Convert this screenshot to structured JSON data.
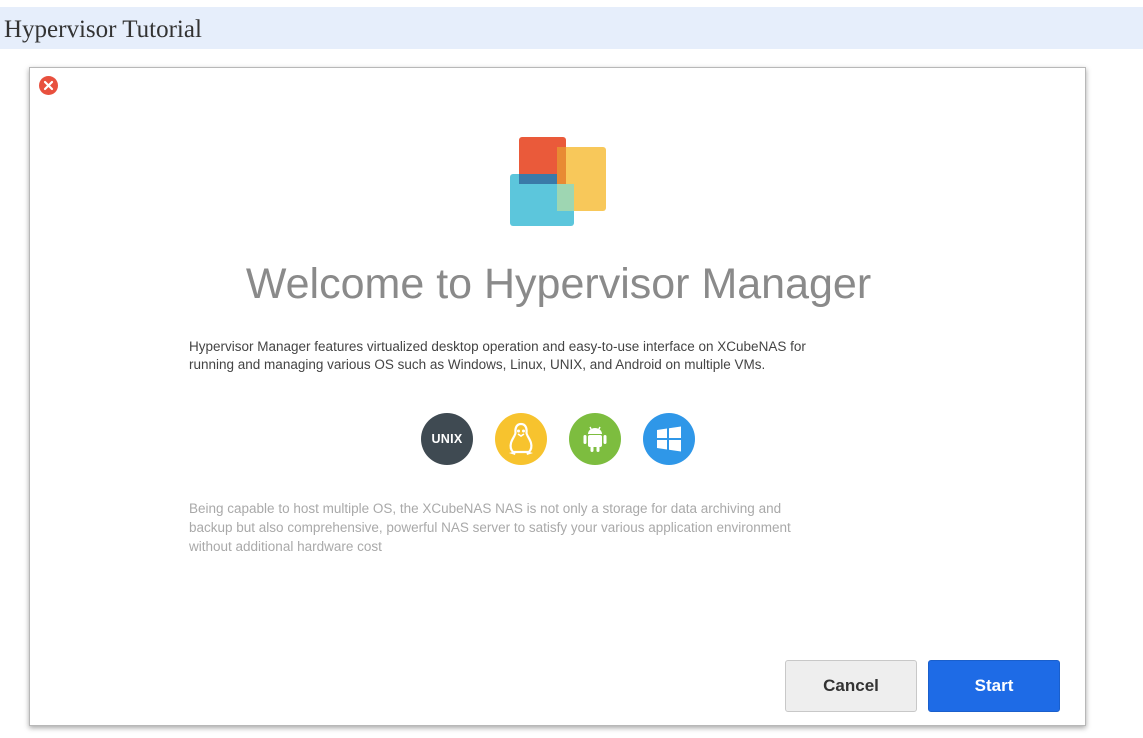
{
  "window": {
    "title": "Hypervisor Tutorial"
  },
  "dialog": {
    "heading": "Welcome to Hypervisor Manager",
    "description_line1": "Hypervisor Manager features virtualized desktop operation and easy-to-use interface on XCubeNAS for",
    "description_line2": "running and managing various OS such as Windows, Linux, UNIX, and Android on multiple VMs.",
    "os_icons": [
      {
        "name": "unix-icon",
        "label": "UNIX",
        "color": "#3f4a52"
      },
      {
        "name": "linux-icon",
        "color": "#f7c32e"
      },
      {
        "name": "android-icon",
        "color": "#7dbd3f"
      },
      {
        "name": "windows-icon",
        "color": "#2f97e8"
      }
    ],
    "note_line1": "Being capable to host multiple OS, the XCubeNAS NAS is not only a storage for data archiving and",
    "note_line2": "backup but also comprehensive, powerful NAS server to satisfy your various application environment",
    "note_line3": "without additional hardware cost",
    "buttons": {
      "cancel": "Cancel",
      "start": "Start"
    }
  },
  "colors": {
    "accent": "#1e6be6",
    "close": "#e8503e",
    "titlebar_bg": "#e6eefb"
  }
}
